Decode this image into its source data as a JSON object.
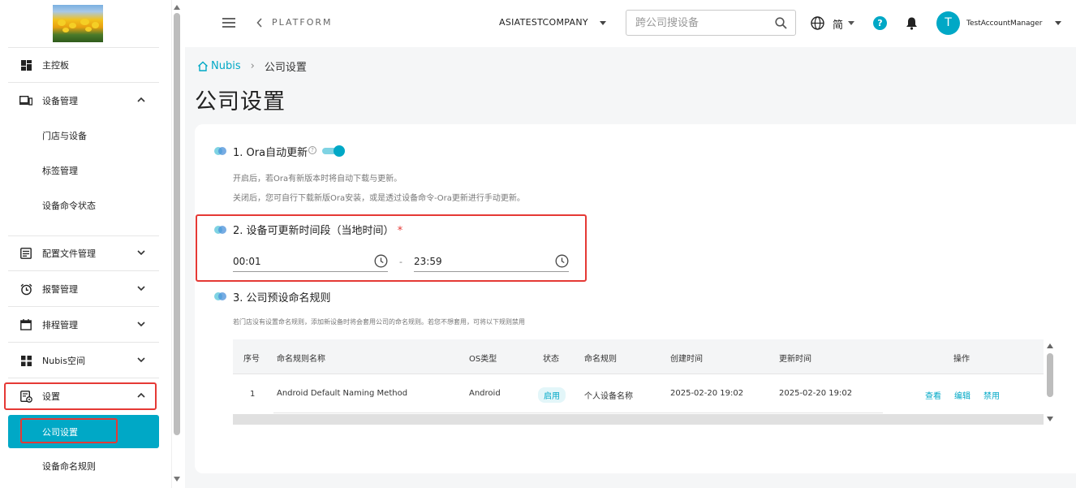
{
  "sidebar": {
    "items": [
      {
        "label": "主控板"
      },
      {
        "label": "设备管理",
        "expanded": true
      },
      {
        "label": "配置文件管理"
      },
      {
        "label": "报警管理"
      },
      {
        "label": "排程管理"
      },
      {
        "label": "Nubis空间"
      },
      {
        "label": "设置",
        "expanded": true
      }
    ],
    "device_sub": [
      "门店与设备",
      "标签管理",
      "设备命令状态"
    ],
    "settings_sub": [
      "公司设置",
      "设备命名规则"
    ]
  },
  "topbar": {
    "platform": "PLATFORM",
    "company": "ASIATESTCOMPANY",
    "search_placeholder": "跨公司搜设备",
    "language": "简",
    "help": "?",
    "avatar_initial": "T",
    "username": "TestAccountManager"
  },
  "breadcrumb": {
    "home": "Nubis",
    "current": "公司设置"
  },
  "page_title": "公司设置",
  "sections": {
    "ora": {
      "title": "1. Ora自动更新",
      "help_mark": "?",
      "enabled": true,
      "desc1": "开启后，若Ora有新版本时将自动下载与更新。",
      "desc2": "关闭后，您可自行下载新版Ora安装，或是透过设备命令-Ora更新进行手动更新。"
    },
    "window": {
      "title": "2. 设备可更新时间段（当地时间）",
      "required_mark": "*",
      "start": "00:01",
      "separator": "-",
      "end": "23:59"
    },
    "naming": {
      "title": "3. 公司预设命名规则",
      "desc": "若门店没有设置命名规则，添加新设备时将会套用公司的命名规则。若您不想套用，可将以下规则禁用"
    }
  },
  "table": {
    "headers": [
      "序号",
      "命名规则名称",
      "OS类型",
      "状态",
      "命名规则",
      "创建时间",
      "更新时间",
      "操作"
    ],
    "rows": [
      {
        "index": "1",
        "name": "Android Default Naming Method",
        "os": "Android",
        "status": "启用",
        "rule": "个人设备名称",
        "created": "2025-02-20 19:02",
        "updated": "2025-02-20 19:02",
        "actions": [
          "查看",
          "编辑",
          "禁用"
        ]
      }
    ]
  },
  "colors": {
    "accent": "#00a8c6",
    "highlight": "#e53935"
  }
}
